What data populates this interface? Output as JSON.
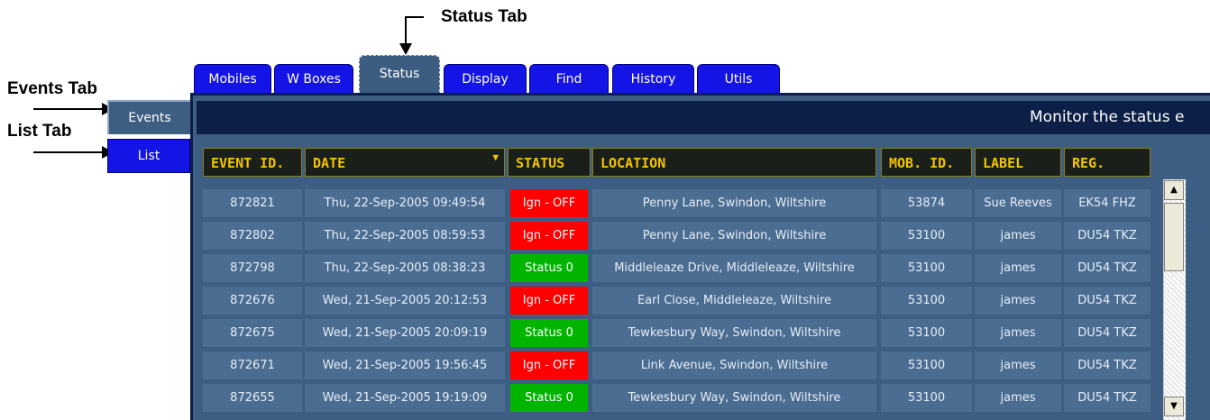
{
  "annotations": {
    "status_tab": "Status Tab",
    "events_tab": "Events Tab",
    "list_tab": "List Tab"
  },
  "tabs": [
    "Mobiles",
    "W Boxes",
    "Status",
    "Display",
    "Find",
    "History",
    "Utils"
  ],
  "active_tab": "Status",
  "side_tabs": {
    "events": "Events",
    "list": "List"
  },
  "title": "Monitor the status e",
  "columns": [
    "EVENT ID.",
    "DATE",
    "STATUS",
    "LOCATION",
    "MOB. ID.",
    "LABEL",
    "REG."
  ],
  "sort_indicator": "▼",
  "rows": [
    {
      "id": "872821",
      "date": "Thu, 22-Sep-2005 09:49:54",
      "status": "Ign - OFF",
      "status_color": "#ff0000",
      "location": "Penny Lane, Swindon, Wiltshire",
      "mob": "53874",
      "label": "Sue Reeves",
      "reg": "EK54 FHZ"
    },
    {
      "id": "872802",
      "date": "Thu, 22-Sep-2005 08:59:53",
      "status": "Ign - OFF",
      "status_color": "#ff0000",
      "location": "Penny Lane, Swindon, Wiltshire",
      "mob": "53100",
      "label": "james",
      "reg": "DU54 TKZ"
    },
    {
      "id": "872798",
      "date": "Thu, 22-Sep-2005 08:38:23",
      "status": "Status 0",
      "status_color": "#00b400",
      "location": "Middleleaze Drive, Middleleaze, Wiltshire",
      "mob": "53100",
      "label": "james",
      "reg": "DU54 TKZ"
    },
    {
      "id": "872676",
      "date": "Wed, 21-Sep-2005 20:12:53",
      "status": "Ign - OFF",
      "status_color": "#ff0000",
      "location": "Earl Close, Middleleaze, Wiltshire",
      "mob": "53100",
      "label": "james",
      "reg": "DU54 TKZ"
    },
    {
      "id": "872675",
      "date": "Wed, 21-Sep-2005 20:09:19",
      "status": "Status 0",
      "status_color": "#00b400",
      "location": "Tewkesbury Way, Swindon, Wiltshire",
      "mob": "53100",
      "label": "james",
      "reg": "DU54 TKZ"
    },
    {
      "id": "872671",
      "date": "Wed, 21-Sep-2005 19:56:45",
      "status": "Ign - OFF",
      "status_color": "#ff0000",
      "location": "Link Avenue, Swindon, Wiltshire",
      "mob": "53100",
      "label": "james",
      "reg": "DU54 TKZ"
    },
    {
      "id": "872655",
      "date": "Wed, 21-Sep-2005 19:19:09",
      "status": "Status 0",
      "status_color": "#00b400",
      "location": "Tewkesbury Way, Swindon, Wiltshire",
      "mob": "53100",
      "label": "james",
      "reg": "DU54 TKZ"
    }
  ],
  "icons": {
    "scroll_up": "up-arrow-icon",
    "scroll_down": "down-arrow-icon"
  },
  "colors": {
    "panel": "#3d5e82",
    "titlebar": "#0b1f47",
    "header_text": "#f5c300",
    "tab_blue": "#1414e6"
  }
}
